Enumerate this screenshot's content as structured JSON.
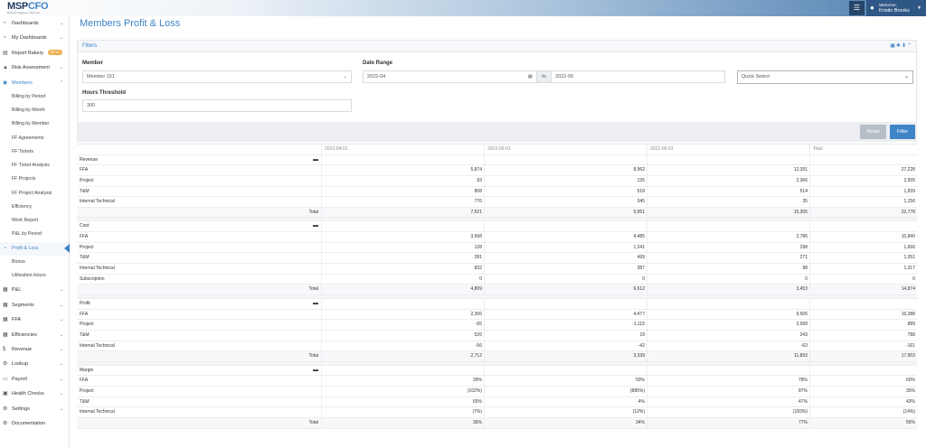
{
  "brand": {
    "logo_main": "MSP",
    "logo_accent": "CFO",
    "logo_tag": "Business Intelligence. Delivered."
  },
  "topbar": {
    "welcome": "Welcome,",
    "username": "Kristin Brooks"
  },
  "sidebar": {
    "top_items": [
      {
        "label": "Dashboards",
        "icon": "dashboard-icon"
      },
      {
        "label": "My Dashboards",
        "icon": "dashboard-icon"
      },
      {
        "label": "Report Bakery",
        "icon": "bakery-icon",
        "badge": "BETA"
      },
      {
        "label": "Risk Assessment",
        "icon": "risk-icon"
      },
      {
        "label": "Members",
        "icon": "members-icon"
      }
    ],
    "sub_items": [
      "Billing by Period",
      "Billing by Month",
      "Billing by Member",
      "FF Agreements",
      "FF Tickets",
      "FF Ticket Analysis",
      "FF Projects",
      "FF Project Analysis",
      "Efficiency",
      "Work Report",
      "P&L by Period",
      "Profit & Loss",
      "Bonus",
      "Utilization Hours"
    ],
    "bottom_items": [
      {
        "label": "P&L",
        "icon": "grid-icon"
      },
      {
        "label": "Segments",
        "icon": "grid-icon"
      },
      {
        "label": "FFA",
        "icon": "grid-icon"
      },
      {
        "label": "Efficiencies",
        "icon": "grid-icon"
      },
      {
        "label": "Revenue",
        "icon": "dollar-icon"
      },
      {
        "label": "Lookup",
        "icon": "gears-icon"
      },
      {
        "label": "Payroll",
        "icon": "payroll-icon"
      },
      {
        "label": "Health Checks",
        "icon": "health-icon"
      },
      {
        "label": "Settings",
        "icon": "gear-icon"
      },
      {
        "label": "Documentation",
        "icon": "gears-icon"
      }
    ]
  },
  "page": {
    "title": "Members Profit & Loss"
  },
  "filters": {
    "title": "Filters",
    "member_label": "Member",
    "member_value": "Member 151",
    "date_label": "Date Range",
    "date_from": "2022-04",
    "date_to_label": "to",
    "date_to": "2022-06",
    "quick_select": "Quick Select",
    "hours_label": "Hours Threshold",
    "hours_value": "300",
    "reset_label": "Reset",
    "filter_label": "Filter"
  },
  "table": {
    "columns": [
      "2022-04-01",
      "2022-05-01",
      "2022-06-01",
      "Total"
    ],
    "sections": [
      {
        "name": "Revenue",
        "rows": [
          {
            "label": "FFA",
            "values": [
              "5,874",
              "8,962",
              "12,391",
              "27,228"
            ]
          },
          {
            "label": "Project",
            "values": [
              "63",
              "126",
              "2,366",
              "2,555"
            ]
          },
          {
            "label": "T&M",
            "values": [
              "808",
              "518",
              "514",
              "1,839"
            ]
          },
          {
            "label": "Internal Technical",
            "values": [
              "776",
              "345",
              "35",
              "1,156"
            ]
          }
        ],
        "total": {
          "label": "Total",
          "values": [
            "7,521",
            "9,951",
            "15,305",
            "32,778"
          ]
        }
      },
      {
        "name": "Cost",
        "rows": [
          {
            "label": "FFA",
            "values": [
              "3,568",
              "4,485",
              "2,786",
              "10,840"
            ]
          },
          {
            "label": "Project",
            "values": [
              "128",
              "1,241",
              "298",
              "1,666"
            ]
          },
          {
            "label": "T&M",
            "values": [
              "281",
              "499",
              "271",
              "1,051"
            ]
          },
          {
            "label": "Internal Technical",
            "values": [
              "832",
              "387",
              "98",
              "1,317"
            ]
          },
          {
            "label": "Subscription",
            "values": [
              "0",
              "0",
              "0",
              "0"
            ]
          }
        ],
        "total": {
          "label": "Total",
          "values": [
            "4,809",
            "6,612",
            "3,453",
            "14,874"
          ]
        }
      },
      {
        "name": "Profit",
        "rows": [
          {
            "label": "FFA",
            "values": [
              "2,306",
              "4,477",
              "9,605",
              "16,388"
            ]
          },
          {
            "label": "Project",
            "values": [
              "-65",
              "-1,115",
              "2,068",
              "889"
            ]
          },
          {
            "label": "T&M",
            "values": [
              "526",
              "19",
              "243",
              "788"
            ]
          },
          {
            "label": "Internal Technical",
            "values": [
              "-56",
              "-42",
              "-63",
              "-161"
            ]
          }
        ],
        "total": {
          "label": "Total",
          "values": [
            "2,712",
            "3,339",
            "11,853",
            "17,903"
          ]
        }
      },
      {
        "name": "Margin",
        "rows": [
          {
            "label": "FFA",
            "values": [
              "39%",
              "50%",
              "78%",
              "60%"
            ]
          },
          {
            "label": "Project",
            "values": [
              "(102%)",
              "(885%)",
              "87%",
              "35%"
            ]
          },
          {
            "label": "T&M",
            "values": [
              "65%",
              "4%",
              "47%",
              "43%"
            ]
          },
          {
            "label": "Internal Technical",
            "values": [
              "(7%)",
              "(12%)",
              "(183%)",
              "(14%)"
            ]
          }
        ],
        "total": {
          "label": "Total",
          "values": [
            "36%",
            "34%",
            "77%",
            "55%"
          ]
        }
      }
    ]
  },
  "colors": {
    "accent": "#3e84c6",
    "topbar_dark": "#2f5785",
    "beta": "#f0ad4e"
  }
}
